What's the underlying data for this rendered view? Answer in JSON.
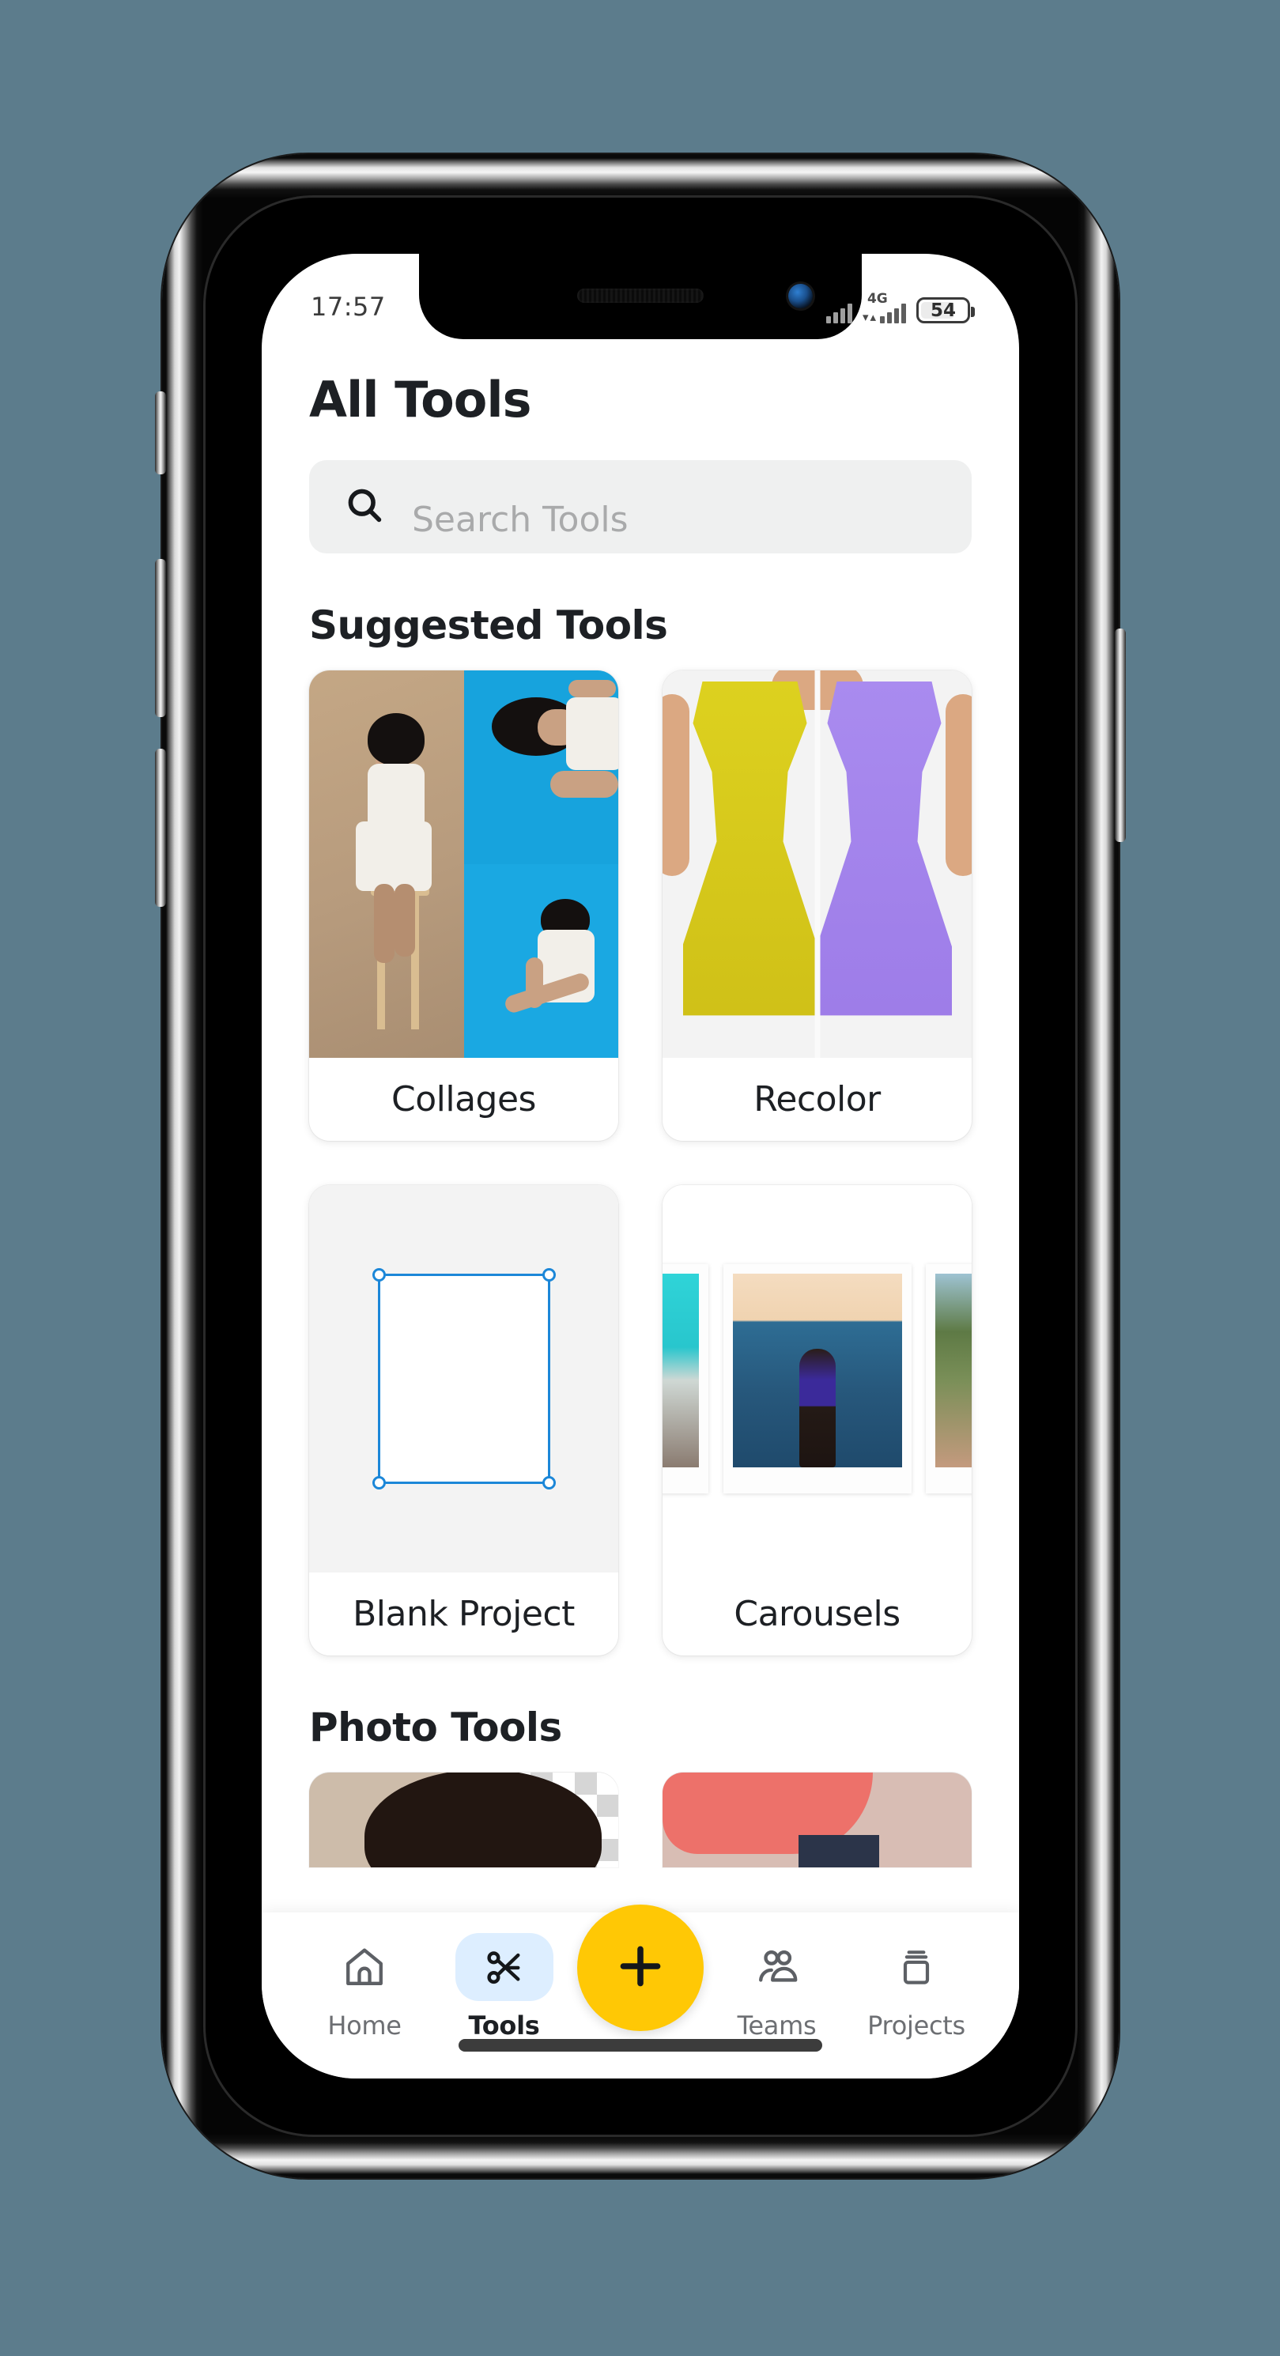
{
  "status_bar": {
    "time": "17:57",
    "network_label": "4G",
    "battery_level": "54",
    "signal_icon": "signal-bars-icon",
    "battery_icon": "battery-icon"
  },
  "header": {
    "title": "All Tools"
  },
  "search": {
    "placeholder": "Search Tools",
    "value": "",
    "icon": "search-icon"
  },
  "sections": [
    {
      "title": "Suggested Tools",
      "cards": [
        {
          "label": "Collages",
          "thumb": "collage-grid-thumbnail"
        },
        {
          "label": "Recolor",
          "thumb": "dress-recolor-thumbnail"
        },
        {
          "label": "Blank Project",
          "thumb": "blank-canvas-thumbnail"
        },
        {
          "label": "Carousels",
          "thumb": "polaroid-carousel-thumbnail"
        }
      ]
    },
    {
      "title": "Photo Tools",
      "cards": [
        {
          "label": "",
          "thumb": "background-remove-thumbnail"
        },
        {
          "label": "",
          "thumb": "retouch-thumbnail"
        }
      ]
    }
  ],
  "bottom_nav": {
    "items": [
      {
        "label": "Home",
        "icon": "home-icon",
        "active": false
      },
      {
        "label": "Tools",
        "icon": "scissors-icon",
        "active": true
      },
      {
        "label": "Teams",
        "icon": "people-icon",
        "active": false
      },
      {
        "label": "Projects",
        "icon": "stack-icon",
        "active": false
      }
    ],
    "fab": {
      "icon": "plus-icon",
      "label": ""
    }
  },
  "colors": {
    "accent_yellow": "#ffc805",
    "active_pill": "#ddeeff",
    "selection_blue": "#1c87d8",
    "page_background": "#5c7c8c",
    "search_field": "#eff0f0"
  }
}
